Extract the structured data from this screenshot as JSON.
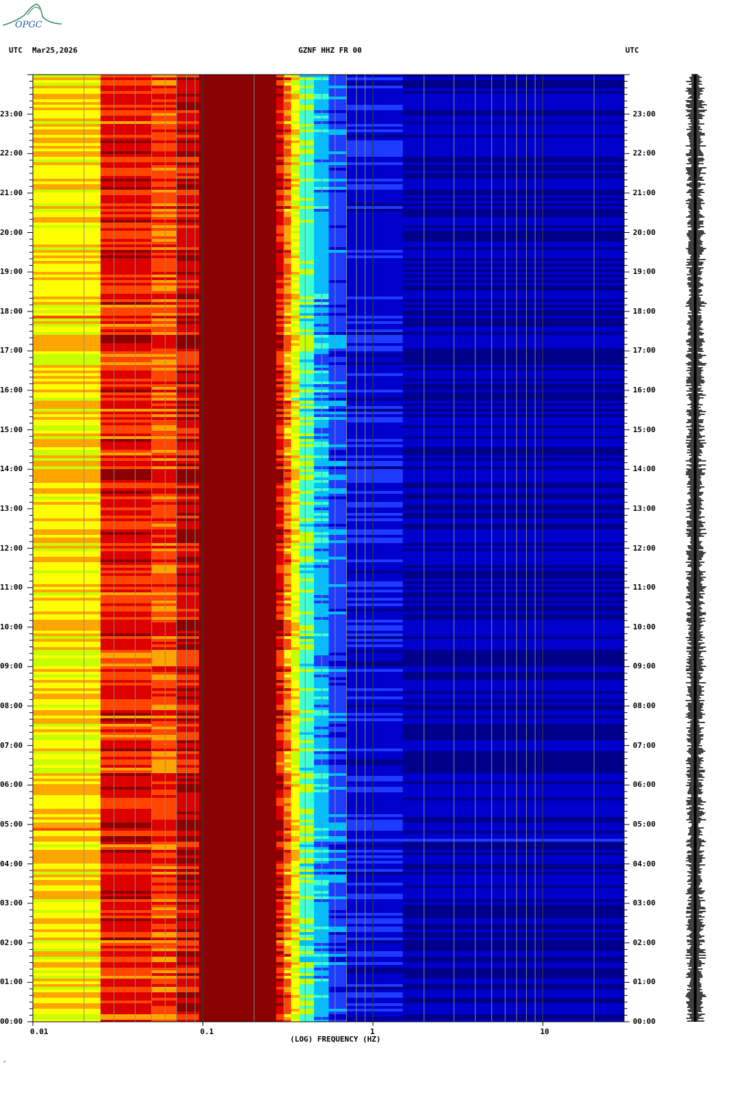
{
  "header": {
    "left_tz": "UTC",
    "date": "Mar25,2026",
    "station": "GZNF HHZ FR 00",
    "right_tz": "UTC"
  },
  "logo": {
    "text": "OPGC",
    "color": "#2e8b57"
  },
  "footer": {
    "mark": "″"
  },
  "chart_data": {
    "type": "heatmap",
    "title": "GZNF HHZ FR 00",
    "xlabel": "(LOG) FREQUENCY (HZ)",
    "ylabel": "UTC",
    "x_scale": "log",
    "xlim": [
      0.01,
      30
    ],
    "ylim_hours": [
      0,
      24
    ],
    "x_ticks": [
      {
        "value": 0.01,
        "label": "0.01"
      },
      {
        "value": 0.1,
        "label": "0.1"
      },
      {
        "value": 1,
        "label": "1"
      },
      {
        "value": 10,
        "label": "10"
      }
    ],
    "y_ticks": [
      {
        "hour": 0,
        "label": "00:00"
      },
      {
        "hour": 1,
        "label": "01:00"
      },
      {
        "hour": 2,
        "label": "02:00"
      },
      {
        "hour": 3,
        "label": "03:00"
      },
      {
        "hour": 4,
        "label": "04:00"
      },
      {
        "hour": 5,
        "label": "05:00"
      },
      {
        "hour": 6,
        "label": "06:00"
      },
      {
        "hour": 7,
        "label": "07:00"
      },
      {
        "hour": 8,
        "label": "08:00"
      },
      {
        "hour": 9,
        "label": "09:00"
      },
      {
        "hour": 10,
        "label": "10:00"
      },
      {
        "hour": 11,
        "label": "11:00"
      },
      {
        "hour": 12,
        "label": "12:00"
      },
      {
        "hour": 13,
        "label": "13:00"
      },
      {
        "hour": 14,
        "label": "14:00"
      },
      {
        "hour": 15,
        "label": "15:00"
      },
      {
        "hour": 16,
        "label": "16:00"
      },
      {
        "hour": 17,
        "label": "17:00"
      },
      {
        "hour": 18,
        "label": "18:00"
      },
      {
        "hour": 19,
        "label": "19:00"
      },
      {
        "hour": 20,
        "label": "20:00"
      },
      {
        "hour": 21,
        "label": "21:00"
      },
      {
        "hour": 22,
        "label": "22:00"
      },
      {
        "hour": 23,
        "label": "23:00"
      }
    ],
    "gridlines_hz": [
      0.02,
      0.03,
      0.04,
      0.05,
      0.06,
      0.07,
      0.08,
      0.09,
      0.2,
      0.3,
      0.4,
      0.5,
      0.6,
      0.7,
      0.8,
      0.9,
      2,
      3,
      4,
      5,
      6,
      7,
      8,
      9,
      20
    ],
    "major_gridlines_hz": [
      0.1,
      1,
      10
    ],
    "colormap": [
      "#00008b",
      "#0000cd",
      "#1e3cff",
      "#00bfff",
      "#40ffd0",
      "#c8ff00",
      "#ffff00",
      "#ffa500",
      "#ff4500",
      "#dc0000",
      "#8b0000"
    ],
    "frequency_bands": [
      {
        "from_hz": 0.01,
        "to_hz": 0.025,
        "level": 0.62
      },
      {
        "from_hz": 0.025,
        "to_hz": 0.05,
        "level": 0.86
      },
      {
        "from_hz": 0.05,
        "to_hz": 0.07,
        "level": 0.8
      },
      {
        "from_hz": 0.07,
        "to_hz": 0.095,
        "level": 0.9
      },
      {
        "from_hz": 0.095,
        "to_hz": 0.27,
        "level": 1.0
      },
      {
        "from_hz": 0.27,
        "to_hz": 0.3,
        "level": 0.88
      },
      {
        "from_hz": 0.3,
        "to_hz": 0.33,
        "level": 0.74
      },
      {
        "from_hz": 0.33,
        "to_hz": 0.37,
        "level": 0.58
      },
      {
        "from_hz": 0.37,
        "to_hz": 0.45,
        "level": 0.42
      },
      {
        "from_hz": 0.45,
        "to_hz": 0.55,
        "level": 0.3
      },
      {
        "from_hz": 0.55,
        "to_hz": 0.7,
        "level": 0.2
      },
      {
        "from_hz": 0.7,
        "to_hz": 1.5,
        "level": 0.12
      },
      {
        "from_hz": 1.5,
        "to_hz": 30,
        "level": 0.05
      }
    ]
  }
}
